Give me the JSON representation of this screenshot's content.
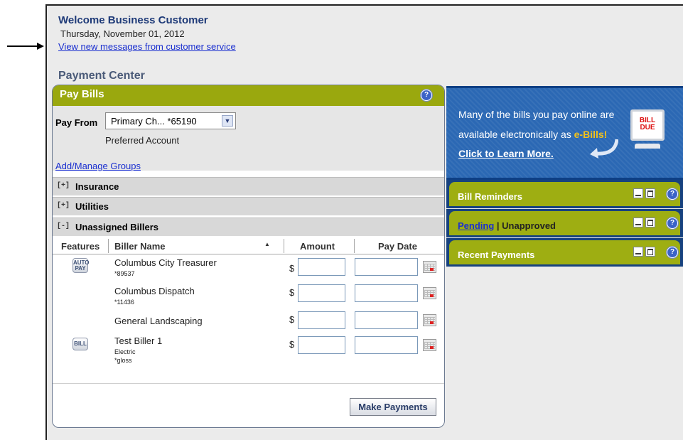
{
  "header": {
    "welcome": "Welcome Business Customer",
    "date": "Thursday, November 01, 2012",
    "messages_link": "View new messages from customer service"
  },
  "payment_center": {
    "title": "Payment Center",
    "pay_bills": {
      "title": "Pay Bills",
      "help_icon": "?",
      "pay_from_label": "Pay From",
      "pay_from_value": "Primary Ch... *65190",
      "preferred_text": "Preferred Account",
      "add_groups_link": "Add/Manage Groups",
      "groups": [
        {
          "marker": "[+]",
          "name": "Insurance"
        },
        {
          "marker": "[+]",
          "name": "Utilities"
        },
        {
          "marker": "[-]",
          "name": "Unassigned Billers"
        }
      ],
      "columns": {
        "features": "Features",
        "biller_name": "Biller Name",
        "amount": "Amount",
        "pay_date": "Pay Date"
      },
      "currency": "$",
      "billers": [
        {
          "name": "Columbus City Treasurer",
          "account": "*89537",
          "feature": "AUTO PAY",
          "amount": "",
          "pay_date": ""
        },
        {
          "name": "Columbus Dispatch",
          "account": "*11436",
          "feature": "",
          "amount": "",
          "pay_date": ""
        },
        {
          "name": "General Landscaping",
          "account": "",
          "feature": "",
          "amount": "",
          "pay_date": ""
        },
        {
          "name": "Test Biller 1",
          "account": "Electric",
          "nickname": "*gloss",
          "feature": "BILL",
          "amount": "",
          "pay_date": ""
        }
      ],
      "submit_label": "Make Payments"
    }
  },
  "ebill_promo": {
    "line1": "Many of the bills you pay online are",
    "line2_prefix": "available electronically as ",
    "line2_highlight": "e-Bills!",
    "line3": "Click to Learn More.",
    "icon_text_1": "BILL",
    "icon_text_2": "DUE"
  },
  "side_panels": {
    "bill_reminders": "Bill Reminders",
    "pending": "Pending",
    "separator": " | ",
    "unapproved": "Unapproved",
    "recent_payments": "Recent Payments",
    "help_icon": "?"
  },
  "colors": {
    "panel_green": "#9aa80e",
    "link_blue": "#1a2fd0",
    "heading_blue": "#1e3a78",
    "promo_blue": "#2b68b4"
  }
}
